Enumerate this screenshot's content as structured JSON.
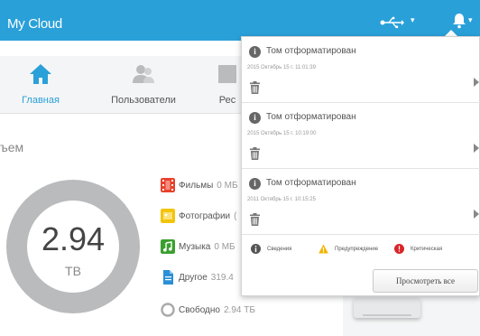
{
  "header": {
    "app_title": "My Cloud",
    "usb_icon": "usb-icon",
    "alert_icon": "alert-icon"
  },
  "nav": {
    "items": [
      {
        "label": "Главная",
        "icon": "home-icon",
        "active": true
      },
      {
        "label": "Пользователи",
        "icon": "users-icon",
        "active": false
      },
      {
        "label": "Рес",
        "icon": "shares-icon",
        "active": false
      }
    ]
  },
  "capacity": {
    "title": "ъем",
    "total_value": "2.94",
    "total_unit": "TB",
    "legend": [
      {
        "label": "Фильмы",
        "size": "0 МБ",
        "color": "#e8412c",
        "icon": "film-icon"
      },
      {
        "label": "Фотографии",
        "size": "(",
        "color": "#f2c40c",
        "icon": "photo-icon"
      },
      {
        "label": "Музыка",
        "size": "0 МБ",
        "color": "#3a9f2e",
        "icon": "music-icon"
      },
      {
        "label": "Другое",
        "size": "319.4",
        "color": "#2a8fd6",
        "icon": "document-icon"
      },
      {
        "label": "Свободно",
        "size": "2.94 ТБ",
        "color": "#cccccc",
        "icon": "free-space-icon"
      }
    ]
  },
  "notifications": {
    "items": [
      {
        "title": "Том отформатирован",
        "timestamp": "2015 Октябрь 15 г. 11:01:39"
      },
      {
        "title": "Том отформатирован",
        "timestamp": "2015 Октябрь 15 г. 10:19:00"
      },
      {
        "title": "Том отформатирован",
        "timestamp": "2011 Октябрь 15 г. 10:15:25"
      }
    ],
    "filters": [
      {
        "label": "Сведения",
        "icon": "info-filter-icon",
        "color": "#555555"
      },
      {
        "label": "Предупреждение",
        "icon": "warning-icon",
        "color": "#f1b400"
      },
      {
        "label": "Критическая",
        "icon": "critical-icon",
        "color": "#d9262b"
      }
    ],
    "view_all_label": "Просмотреть все"
  },
  "colors": {
    "accent": "#2aa0d9",
    "donut_gray": "#b9bbbd"
  }
}
